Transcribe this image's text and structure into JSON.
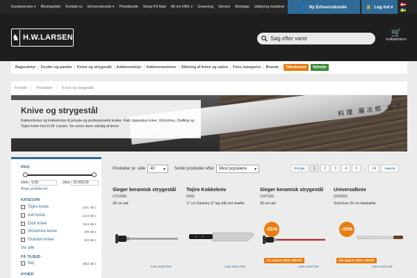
{
  "topnav": [
    "Kundeservice ▾",
    "Åbningstider",
    "Kontakt os",
    "Erhvervskunde ▾",
    "Privatkunde",
    "Skarp På Mad",
    "Alt om HWL ▾",
    "Gravering",
    "Service",
    "Montage",
    "Udlejning maskiner"
  ],
  "buttons": {
    "pro": "Ny Erhvervskunde",
    "login": "Log ind ▾"
  },
  "logo": {
    "mark": "♞",
    "text": "H.W.LARSEN"
  },
  "search": {
    "placeholder": "Søg efter varer"
  },
  "cart": {
    "label": "Indkøbskurv"
  },
  "categories": [
    "Bageudstyr",
    "Gryder og pander",
    "Knive og strygestål",
    "Køkkenudstyr",
    "Køkkenmaskiner",
    "Slibning af knive og sakse",
    "Flere kategorier",
    "Brands"
  ],
  "badges": [
    {
      "label": "Tilbudsvarer",
      "color": "#e87d10"
    },
    {
      "label": "Nyheder",
      "color": "#3c8c3c"
    }
  ],
  "breadcrumb": [
    "Forside",
    "Produkter",
    "Knive og strygestål"
  ],
  "hero": {
    "title": "Knive og strygestål",
    "description": "Køkkenknive og kokkeknive til private og professionelle kokke. Køb Japanske knive, Victorinox, Zwilling og Tojiro knive hos H.W. Larsen. Se vores store udvalg af knive",
    "kanji": "料理 藤次郎 包丁"
  },
  "filters": {
    "price_heading": "PRIS",
    "price_min": "0,00",
    "price_max": "22.000,00",
    "currency": "DKK",
    "custom_interval": "Angiv prisinterval",
    "category_heading": "KATEGORI",
    "categories": [
      {
        "label": "Tojiro knive",
        "count": "(161 stk.)"
      },
      {
        "label": "Icel knive",
        "count": "(143 stk.)"
      },
      {
        "label": "Dick knive",
        "count": "(114 stk.)"
      },
      {
        "label": "Victorinox knive",
        "count": "(99 stk.)"
      },
      {
        "label": "Granton knive",
        "count": "(63 stk.)"
      }
    ],
    "see_all": "Vis alle",
    "offer_heading": "PÅ TILBUD",
    "offer_option": {
      "label": "Nej",
      "count": "(652 stk.)"
    },
    "new_heading": "NYHED"
  },
  "toolbar": {
    "per_page_label": "Produkter pr. side",
    "per_page_value": "40",
    "sort_label": "Sortér produkter efter",
    "sort_value": "Mest populære"
  },
  "pager": {
    "prev": "forrige",
    "pages": [
      "1",
      "2",
      "3",
      "4",
      "5"
    ],
    "dots": "...",
    "last": "24",
    "next": "næste"
  },
  "products": [
    {
      "name": "Sieger keramisk strygestål",
      "sku": "(721928)",
      "desc": "28 cm rød",
      "more": "Læs mere her"
    },
    {
      "name": "Tojiro Kokkekniv",
      "sku": "(F60)",
      "desc": "17 cm Santoku 37 lag stål sort skæfte",
      "more": "Læs mere her"
    },
    {
      "name": "Sieger keramisk strygestål",
      "sku": "(197120)",
      "desc": "28 cm rød",
      "more": "Læs mere her",
      "discount": "-51%",
      "saving": "Du sparer DKK 280,00"
    },
    {
      "name": "Universalkniv",
      "sku": "(293026)",
      "desc": "Victorinox 26 cm træskæfte",
      "more": "Læs mere her",
      "discount": "-35%",
      "saving": "Du sparer DKK 140,00"
    }
  ],
  "colors": {
    "accent": "#2f6b96",
    "offer": "#e87d10",
    "new": "#3c8c3c",
    "dark": "#1e1e1e"
  }
}
